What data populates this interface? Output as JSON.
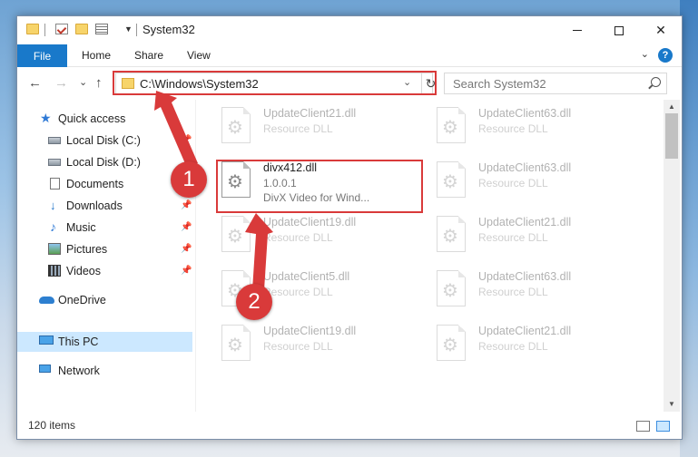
{
  "window": {
    "title": "System32",
    "quick_access_icons": [
      "folder-icon",
      "properties-check-icon",
      "new-folder-icon",
      "properties-icon"
    ],
    "controls": {
      "minimize": "",
      "maximize": "",
      "close": "✕"
    }
  },
  "ribbon": {
    "tabs": [
      {
        "label": "File"
      },
      {
        "label": "Home"
      },
      {
        "label": "Share"
      },
      {
        "label": "View"
      }
    ],
    "help_label": "?"
  },
  "navigation": {
    "back": "←",
    "forward": "→",
    "recent": "⌄",
    "up": "↑",
    "address": "C:\\Windows\\System32",
    "refresh": "↻",
    "search_placeholder": "Search System32"
  },
  "sidebar": {
    "items": [
      {
        "label": "Quick access",
        "icon": "star-icon",
        "pinned": false
      },
      {
        "label": "Local Disk (C:)",
        "icon": "disk-icon",
        "pinned": true
      },
      {
        "label": "Local Disk (D:)",
        "icon": "disk-icon",
        "pinned": false
      },
      {
        "label": "Documents",
        "icon": "documents-icon",
        "pinned": true
      },
      {
        "label": "Downloads",
        "icon": "downloads-icon",
        "pinned": true
      },
      {
        "label": "Music",
        "icon": "music-icon",
        "pinned": true
      },
      {
        "label": "Pictures",
        "icon": "pictures-icon",
        "pinned": true
      },
      {
        "label": "Videos",
        "icon": "videos-icon",
        "pinned": true
      },
      {
        "label": "OneDrive",
        "icon": "onedrive-icon",
        "pinned": false
      },
      {
        "label": "This PC",
        "icon": "this-pc-icon",
        "pinned": false,
        "selected": true
      },
      {
        "label": "Network",
        "icon": "network-icon",
        "pinned": false
      }
    ]
  },
  "files": {
    "selected": {
      "name": "divx412.dll",
      "version": "1.0.0.1",
      "description": "DivX Video for Wind..."
    },
    "background": [
      {
        "name": "UpdateClient21.dll",
        "type": "Resource DLL"
      },
      {
        "name": "UpdateClient63.dll",
        "type": "Resource DLL"
      },
      {
        "name": "UpdateClient63.dll",
        "type": "Resource DLL"
      },
      {
        "name": "UpdateClient19.dll",
        "type": "Resource DLL"
      },
      {
        "name": "UpdateClient21.dll",
        "type": "Resource DLL"
      },
      {
        "name": "UpdateClient5.dll",
        "type": "Resource DLL"
      },
      {
        "name": "UpdateClient63.dll",
        "type": "Resource DLL"
      },
      {
        "name": "UpdateClient19.dll",
        "type": "Resource DLL"
      },
      {
        "name": "UpdateClient21.dll",
        "type": "Resource DLL"
      }
    ]
  },
  "status": {
    "item_count": "120 items"
  },
  "annotations": {
    "step1": "1",
    "step2": "2",
    "color": "#d93a3a"
  }
}
